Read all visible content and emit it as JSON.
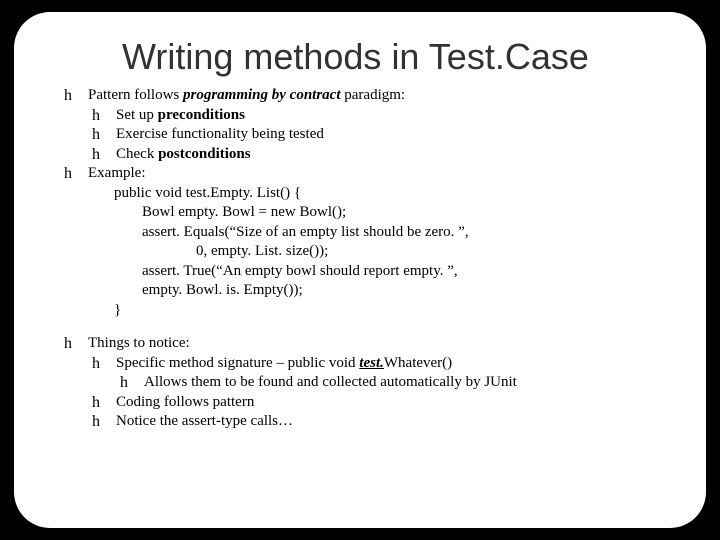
{
  "title": "Writing methods in Test.Case",
  "p1": {
    "lead": "Pattern follows ",
    "em": "programming by contract",
    "tail": " paradigm:",
    "s1a": "Set up ",
    "s1b": "preconditions",
    "s2": "Exercise functionality being tested",
    "s3a": "Check ",
    "s3b": "postconditions"
  },
  "p2": {
    "lead": "Example:",
    "c1": "public void test.Empty. List() {",
    "c2": "Bowl empty. Bowl = new Bowl();",
    "c3": "assert. Equals(“Size of an empty list should be zero. ”,",
    "c4": "0, empty. List. size());",
    "c5": "assert. True(“An empty bowl should report empty. ”,",
    "c6": "empty. Bowl. is. Empty());",
    "c7": "}"
  },
  "p3": {
    "lead": "Things to notice:",
    "s1a": "Specific method signature – public void ",
    "s1b": "test.",
    "s1c": "Whatever()",
    "s1s": "Allows them to be found and collected automatically by JUnit",
    "s2": "Coding follows pattern",
    "s3": "Notice the assert-type calls…"
  },
  "bullet": "h"
}
